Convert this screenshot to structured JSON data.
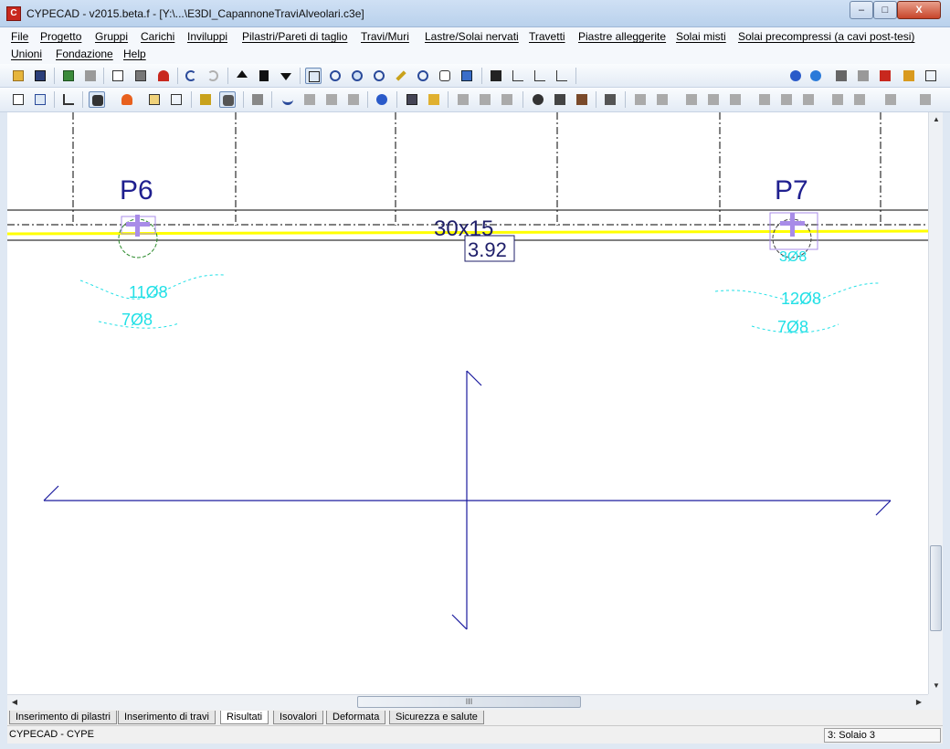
{
  "window": {
    "title": "CYPECAD - v2015.beta.f - [Y:\\...\\E3DI_CapannoneTraviAlveolari.c3e]",
    "icon_text": "C",
    "minimize": "–",
    "maximize": "□",
    "close": "X"
  },
  "menu": [
    "File",
    "Progetto",
    "Gruppi",
    "Carichi",
    "Inviluppi",
    "Pilastri/Pareti di taglio",
    "Travi/Muri",
    "Lastre/Solai nervati",
    "Travetti",
    "Piastre alleggerite",
    "Solai misti",
    "Solai precompressi (a cavi post-tesi)",
    "Unioni",
    "Fondazione",
    "Help"
  ],
  "toolbar1_icons": [
    "open-folder-icon",
    "save-icon",
    "structure-icon",
    "structure-gray-icon",
    "calculate-icon",
    "magnet-icon",
    "undo-icon",
    "redo-icon",
    "up-triangle-icon",
    "up-down-icon",
    "down-triangle-icon",
    "zoom-window-icon",
    "pan-zoom-icon",
    "zoom-all-icon",
    "zoom-extents-icon",
    "pencil-icon",
    "search-icon",
    "hand-pan-icon",
    "redraw-icon",
    "binoculars-icon",
    "pointer-icon",
    "angle-icon",
    "axis-icon",
    "help-icon",
    "globe-icon",
    "print-icon",
    "view-icon",
    "export-icon",
    "settings-icon",
    "exit-icon"
  ],
  "toolbar2_icons": [
    "columns-list-icon",
    "edit-table-icon",
    "stairs-icon",
    "phone-icon",
    "fire-icon",
    "cube-icon",
    "cube-outline-icon",
    "tools-icon",
    "gear-phone-icon",
    "block-icon",
    "beam-v-icon",
    "beam-y-icon",
    "beam-x-icon",
    "beam-x2-icon",
    "info-icon",
    "report-icon",
    "lock-icon",
    "grid-a-icon",
    "grid-b-icon",
    "grid-c-icon",
    "eye-icon",
    "mesh-icon",
    "mesh-color-icon",
    "tree-icon",
    "bar-a-icon",
    "bar-b-icon",
    "bar-c-icon",
    "bar-d-icon",
    "bar-e-icon",
    "bar-f-icon",
    "bar-g-icon",
    "bar-h-icon",
    "bar-i-icon",
    "bar-j-icon",
    "bar-k-icon"
  ],
  "drawing": {
    "column_left": "P6",
    "column_right": "P7",
    "beam_section": "30x15",
    "beam_length": "3.92",
    "rebar_left_top": "11Ø8",
    "rebar_left_bottom": "7Ø8",
    "rebar_right_top": "12Ø8",
    "rebar_right_bottom": "7Ø8",
    "rebar_right_small": "3Ø8",
    "colors": {
      "column_label": "#1f1f8f",
      "beam": "#ffff00",
      "rebar": "#22e0e6",
      "column_symbol": "#a88ce8",
      "cross": "#1a1a9e"
    }
  },
  "hscroll_grip": "III",
  "tabs": [
    "Inserimento di pilastri",
    "Inserimento di travi",
    "Risultati",
    "Isovalori",
    "Deformata",
    "Sicurezza e salute"
  ],
  "active_tab": "Risultati",
  "status": {
    "left": "CYPECAD - CYPE",
    "right": "3: Solaio 3"
  }
}
